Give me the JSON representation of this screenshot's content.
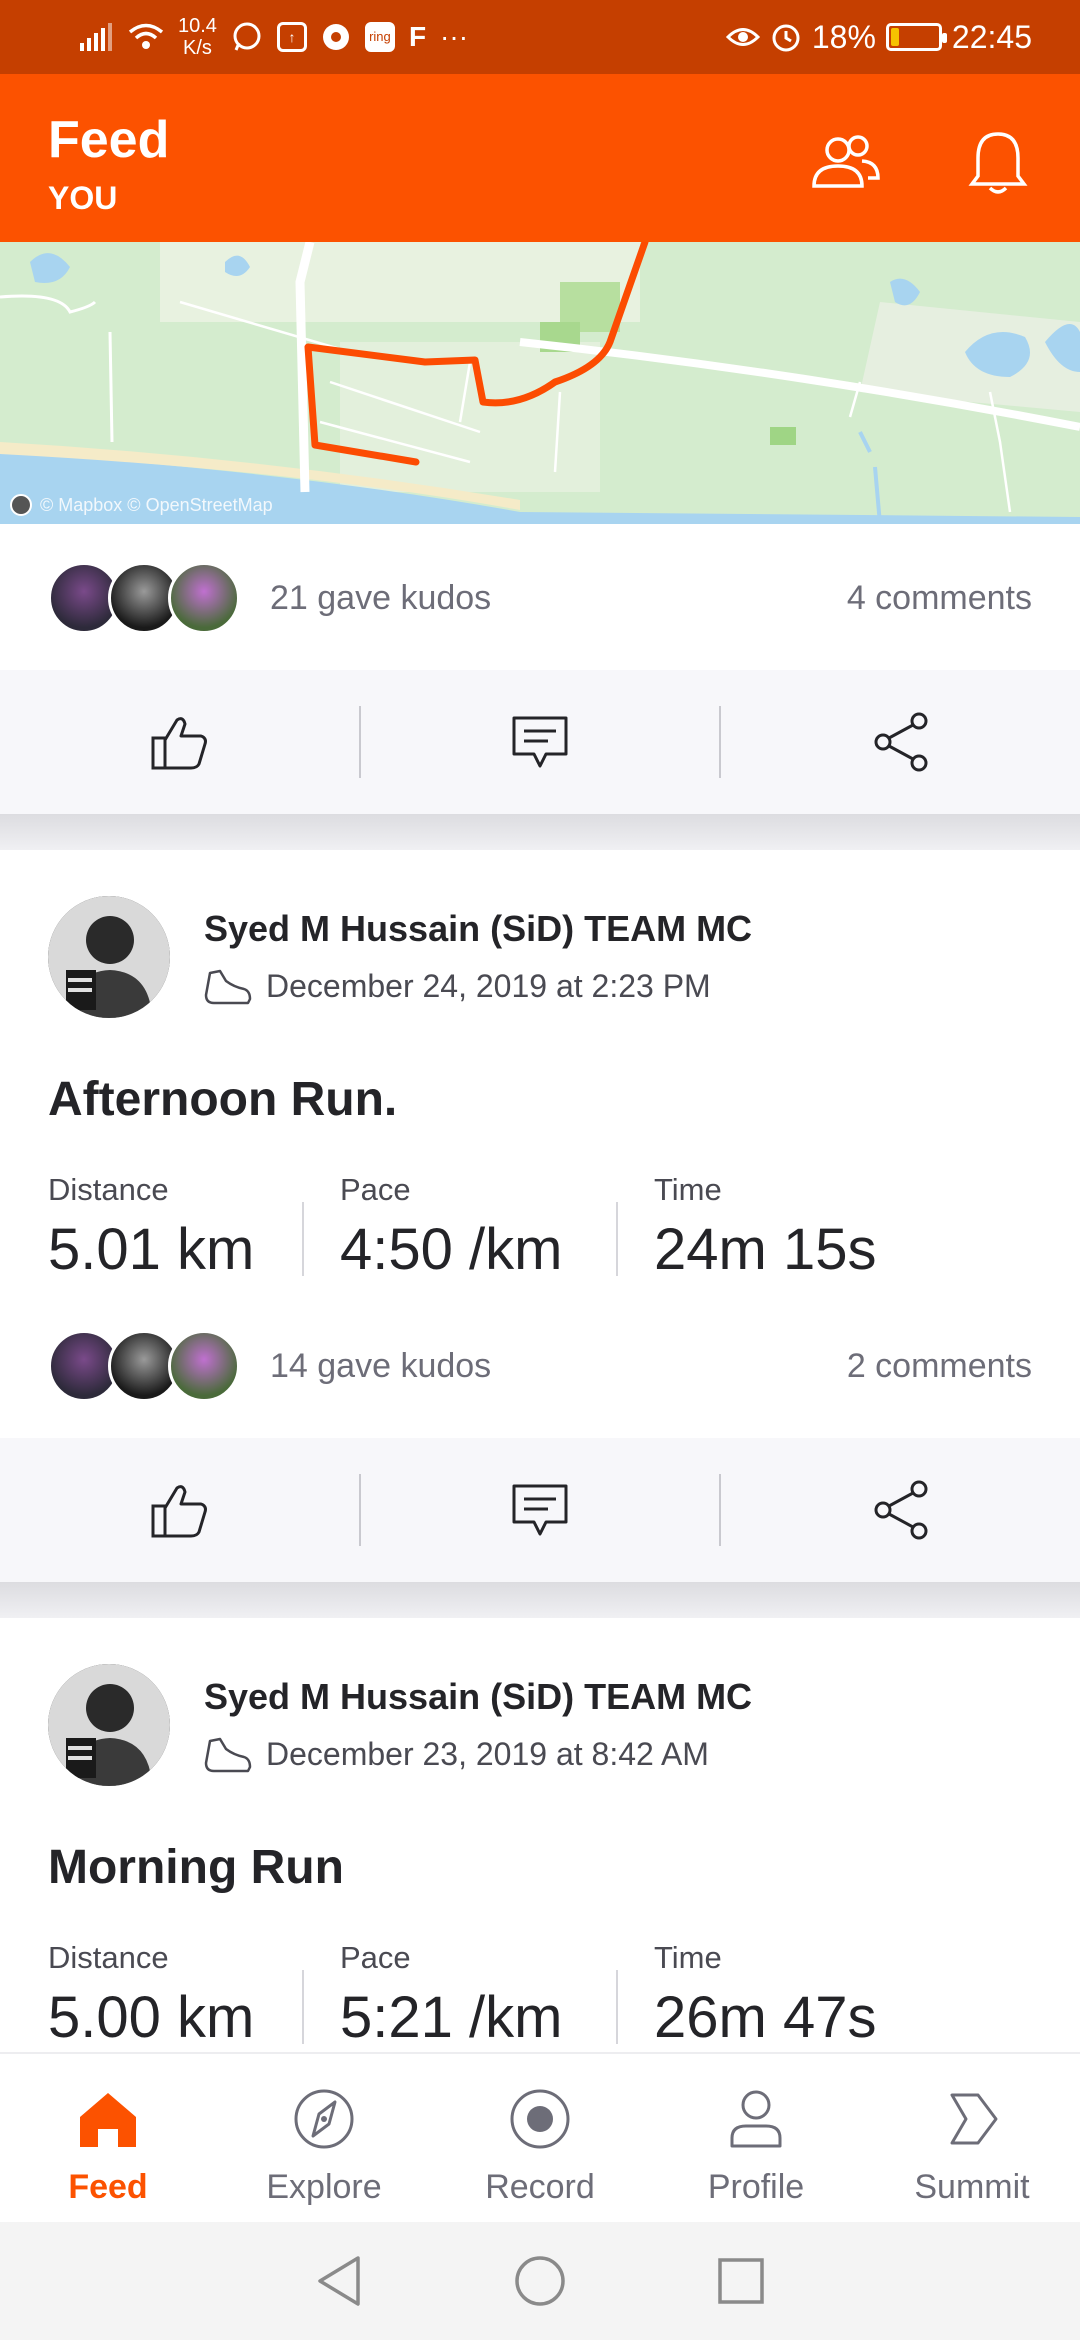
{
  "status_bar": {
    "network_speed_value": "10.4",
    "network_speed_unit": "K/s",
    "ring_label": "ring",
    "f_label": "F",
    "more": "···",
    "battery": "18%",
    "battery_level": 0.18,
    "time": "22:45"
  },
  "header": {
    "title": "Feed",
    "subtitle": "YOU"
  },
  "map": {
    "attribution": "© Mapbox © OpenStreetMap"
  },
  "post1": {
    "kudos": "21 gave kudos",
    "comments": "4 comments"
  },
  "post2": {
    "athlete": "Syed M Hussain (SiD) TEAM MC",
    "date": "December 24, 2019 at 2:23 PM",
    "title": "Afternoon Run.",
    "stats": [
      {
        "label": "Distance",
        "value": "5.01 km"
      },
      {
        "label": "Pace",
        "value": "4:50 /km"
      },
      {
        "label": "Time",
        "value": "24m 15s"
      }
    ],
    "kudos": "14 gave kudos",
    "comments": "2 comments"
  },
  "post3": {
    "athlete": "Syed M Hussain (SiD) TEAM MC",
    "date": "December 23, 2019 at 8:42 AM",
    "title": "Morning Run",
    "stats": [
      {
        "label": "Distance",
        "value": "5.00 km"
      },
      {
        "label": "Pace",
        "value": "5:21 /km"
      },
      {
        "label": "Time",
        "value": "26m 47s"
      }
    ]
  },
  "bottom_nav": [
    {
      "label": "Feed",
      "icon": "home-icon",
      "active": true
    },
    {
      "label": "Explore",
      "icon": "compass-icon",
      "active": false
    },
    {
      "label": "Record",
      "icon": "record-icon",
      "active": false
    },
    {
      "label": "Profile",
      "icon": "person-icon",
      "active": false
    },
    {
      "label": "Summit",
      "icon": "summit-chevron-icon",
      "active": false
    }
  ],
  "colors": {
    "brand": "#fc5200",
    "status_bar": "#c53f00",
    "route": "#fc4c02"
  }
}
